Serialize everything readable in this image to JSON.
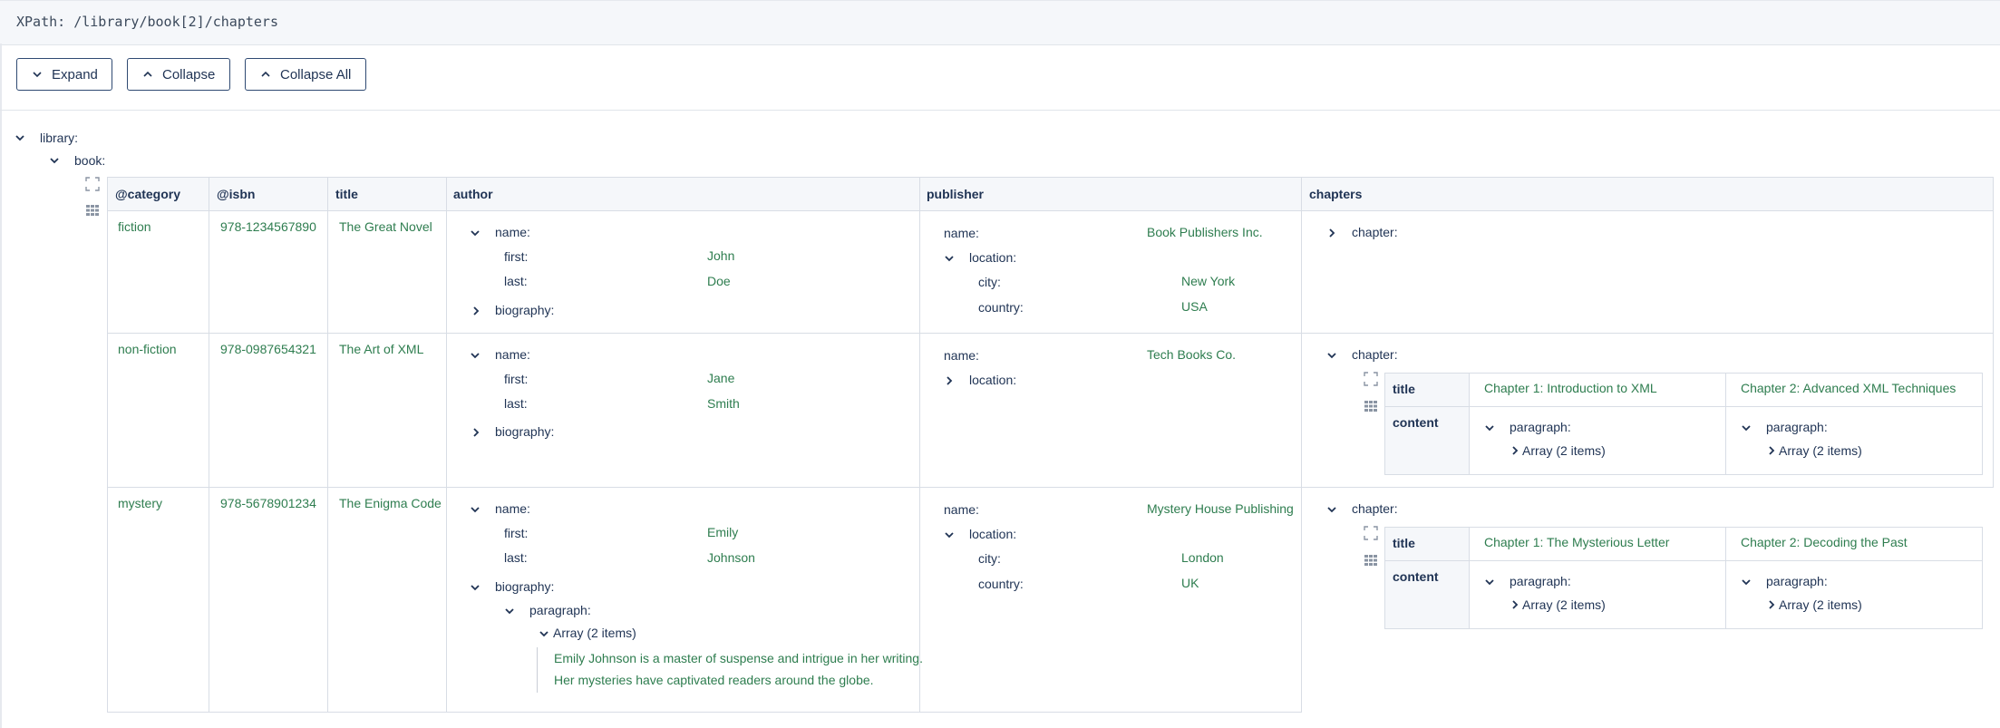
{
  "xpath": "XPath: /library/book[2]/chapters",
  "toolbar": {
    "expand": "Expand",
    "collapse": "Collapse",
    "collapse_all": "Collapse All"
  },
  "tree": {
    "root_label": "library:",
    "book_label": "book:",
    "columns": [
      "@category",
      "@isbn",
      "title",
      "author",
      "publisher",
      "chapters"
    ],
    "keys": {
      "name": "name:",
      "first": "first:",
      "last": "last:",
      "biography": "biography:",
      "location": "location:",
      "city": "city:",
      "country": "country:",
      "chapter": "chapter:",
      "paragraph": "paragraph:",
      "title": "title",
      "content": "content",
      "array2": "Array (2 items)"
    },
    "rows": [
      {
        "category": "fiction",
        "isbn": "978-1234567890",
        "title": "The Great Novel",
        "first": "John",
        "last": "Doe",
        "publisher_name": "Book Publishers Inc.",
        "city": "New York",
        "country": "USA"
      },
      {
        "category": "non-fiction",
        "isbn": "978-0987654321",
        "title": "The Art of XML",
        "first": "Jane",
        "last": "Smith",
        "publisher_name": "Tech Books Co.",
        "chapter_titles": [
          "Chapter 1: Introduction to XML",
          "Chapter 2: Advanced XML Techniques"
        ]
      },
      {
        "category": "mystery",
        "isbn": "978-5678901234",
        "title": "The Enigma Code",
        "first": "Emily",
        "last": "Johnson",
        "bio_lines": [
          "Emily Johnson is a master of suspense and intrigue in her writing.",
          "Her mysteries have captivated readers around the globe."
        ],
        "publisher_name": "Mystery House Publishing",
        "city": "London",
        "country": "UK",
        "chapter_titles": [
          "Chapter 1: The Mysterious Letter",
          "Chapter 2: Decoding the Past"
        ]
      }
    ]
  },
  "icons": {
    "down": "chevron-down-icon",
    "right": "chevron-right-icon",
    "up": "chevron-up-icon",
    "expand": "expand-icon",
    "grid": "grid-icon"
  }
}
